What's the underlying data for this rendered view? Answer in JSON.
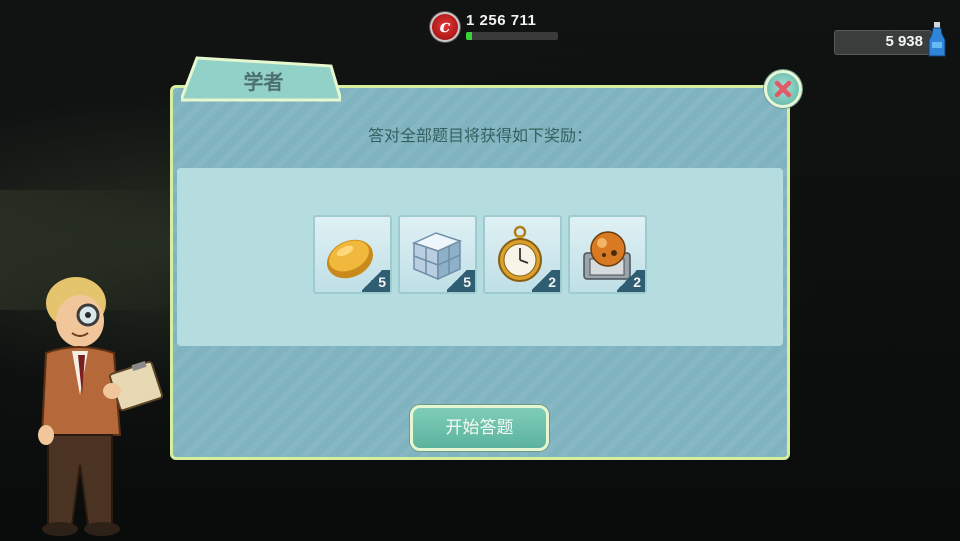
{
  "hud": {
    "caps_value": "1 256 711",
    "caps_icon": "bottle-cap-icon",
    "caps_progress": 0.06,
    "quantum_value": "5 938",
    "quantum_icon": "nuka-quantum-icon"
  },
  "dialog": {
    "title": "学者",
    "close_icon": "close-icon",
    "reward_heading": "答对全部题目将获得如下奖励：",
    "rewards": [
      {
        "icon": "bread-icon",
        "count": "5"
      },
      {
        "icon": "ice-cube-icon",
        "count": "5"
      },
      {
        "icon": "pocket-watch-icon",
        "count": "2"
      },
      {
        "icon": "cooker-icon",
        "count": "2"
      }
    ],
    "start_button": "开始答题"
  },
  "character": {
    "icon": "scholar-character-icon"
  }
}
